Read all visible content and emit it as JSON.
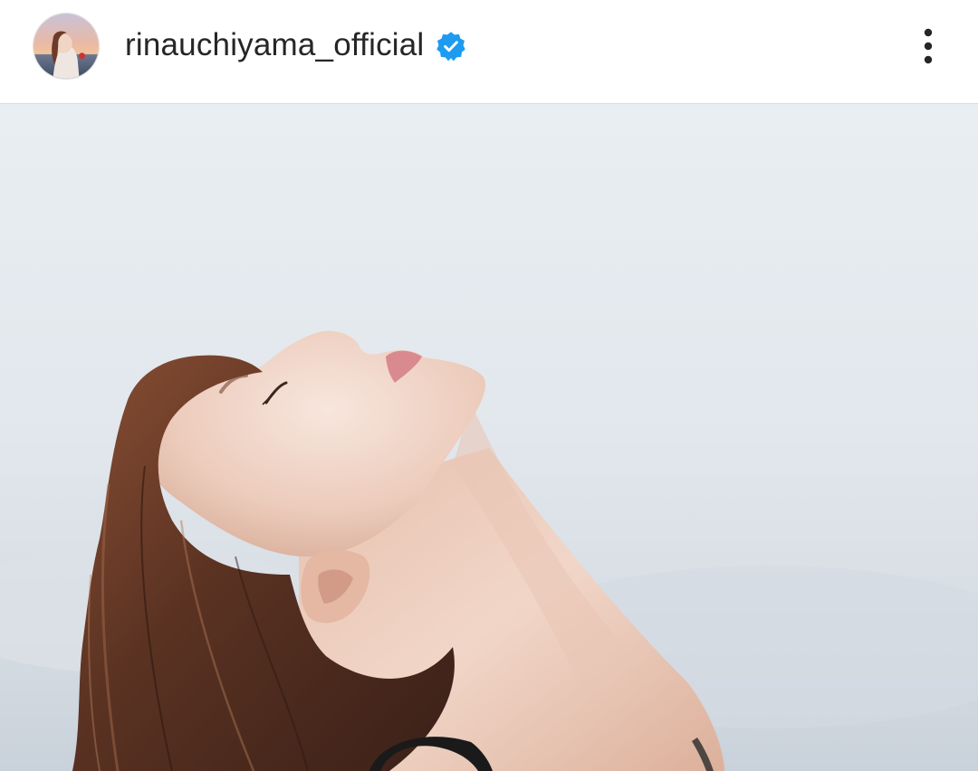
{
  "post": {
    "username": "rinauchiyama_official",
    "verified": true
  },
  "icons": {
    "avatar": "profile-photo",
    "badge": "verified-badge-icon",
    "menu": "more-options-icon"
  },
  "colors": {
    "verified_blue": "#1D9BF0",
    "text_primary": "#262626",
    "divider": "#dbdbdb"
  }
}
